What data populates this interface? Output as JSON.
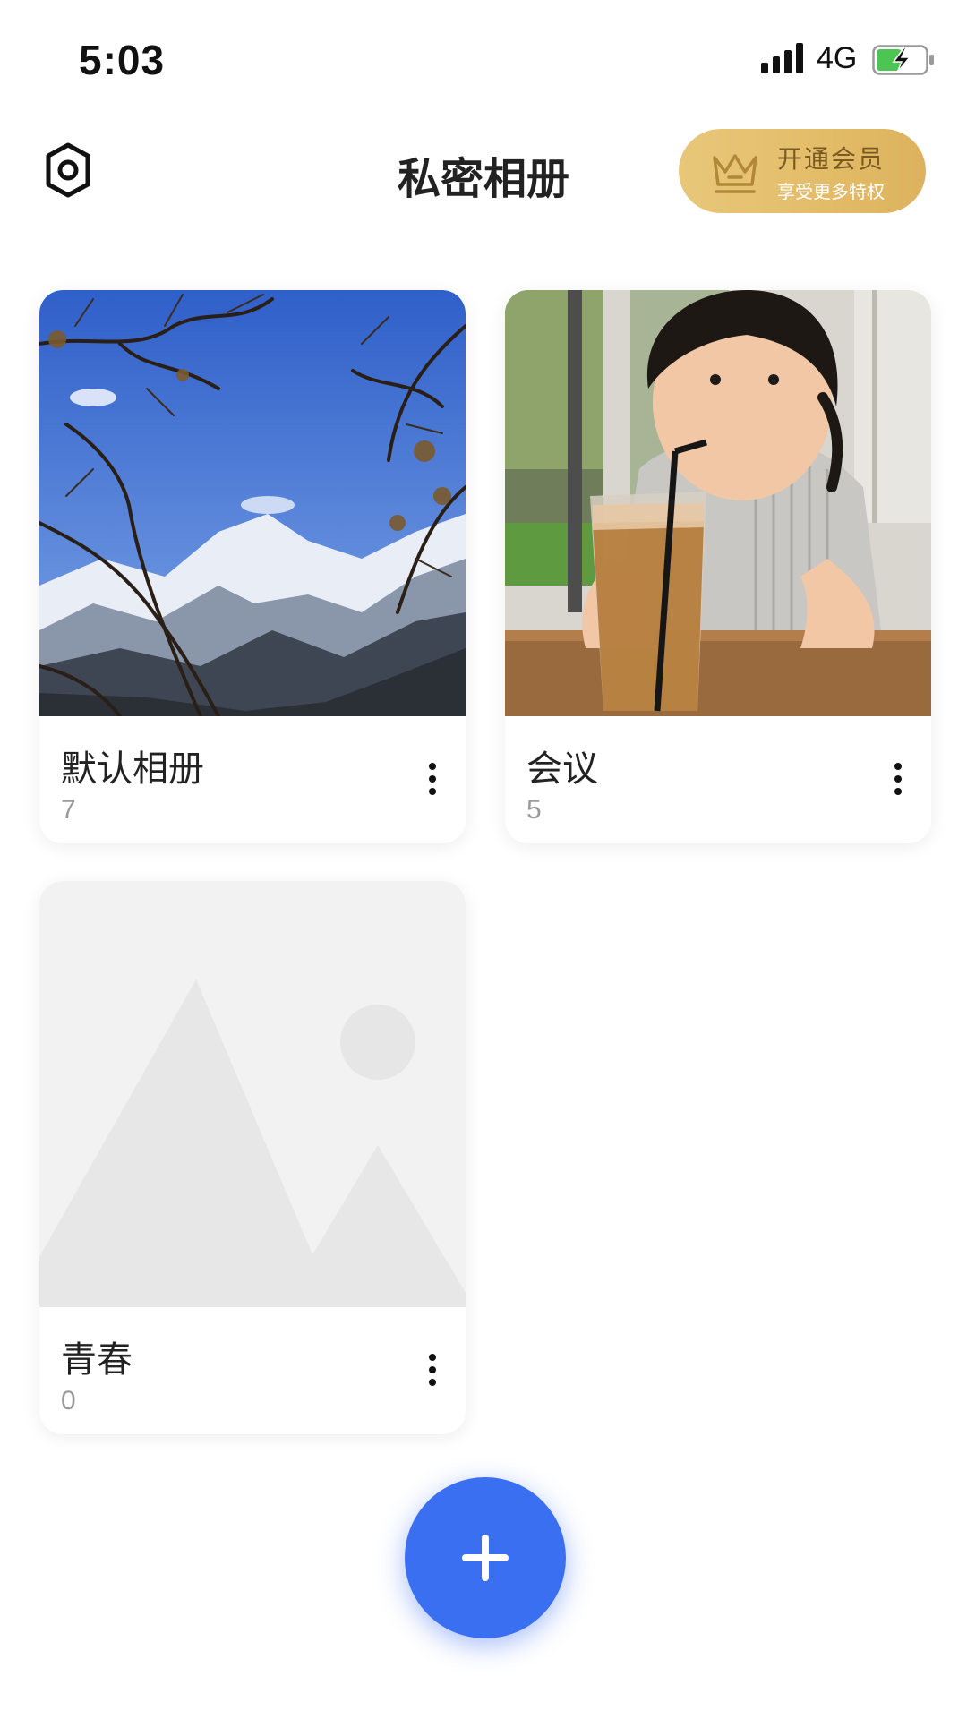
{
  "status_bar": {
    "time": "5:03",
    "network": "4G",
    "icons": [
      "signal-icon",
      "battery-charging-icon"
    ]
  },
  "header": {
    "title": "私密相册",
    "settings_icon": "gear-icon",
    "vip": {
      "title": "开通会员",
      "subtitle": "享受更多特权",
      "icon": "crown-icon"
    }
  },
  "albums": [
    {
      "name": "默认相册",
      "count": "7",
      "cover": "snowy-mountain-photo"
    },
    {
      "name": "会议",
      "count": "5",
      "cover": "child-drinking-photo"
    },
    {
      "name": "青春",
      "count": "0",
      "cover": "placeholder-image"
    }
  ],
  "fab": {
    "icon": "plus-icon"
  },
  "colors": {
    "accent": "#3b6ff2",
    "vip_gold": "#e3bc68",
    "count_gray": "#9a9a9a"
  }
}
